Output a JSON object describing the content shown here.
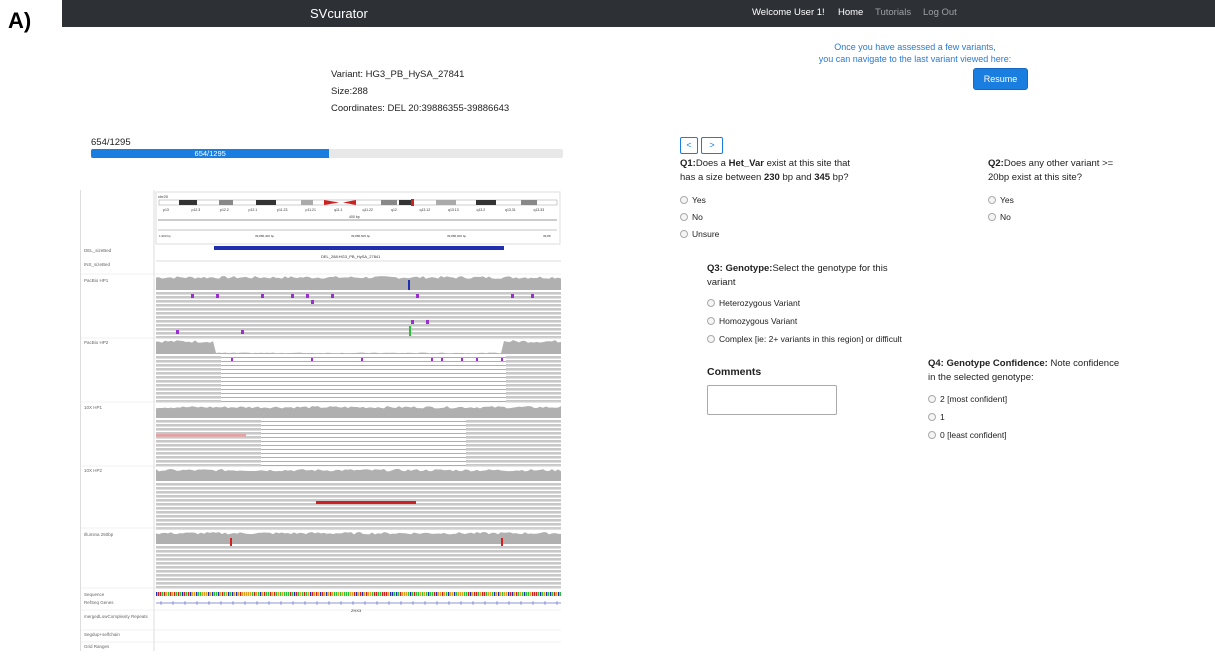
{
  "panel_label": "A)",
  "navbar": {
    "brand": "SVcurator",
    "welcome": "Welcome User 1!",
    "home": "Home",
    "tutorials": "Tutorials",
    "logout": "Log Out"
  },
  "resume": {
    "hint_line1": "Once you have assessed a few variants,",
    "hint_line2": "you can navigate to the last variant viewed here:",
    "button": "Resume"
  },
  "variant": {
    "name_line": "Variant: HG3_PB_HySA_27841",
    "size_line": "Size:288",
    "coords_line": "Coordinates: DEL 20:39886355-39886643"
  },
  "progress": {
    "label": "654/1295",
    "bar_label": "654/1295",
    "fraction": 0.505
  },
  "igv": {
    "chrom": "chr20",
    "bands": [
      "p13",
      "p12.3",
      "p12.2",
      "p12.1",
      "p11.23",
      "p11.21",
      "q11.1",
      "q11.22",
      "q12",
      "q13.12",
      "q13.13",
      "q13.2",
      "q13.31",
      "q13.33"
    ],
    "scale_label": "400 bp",
    "ruler": [
      "1,900 bp",
      "39,886,400 bp",
      "39,886,500 bp",
      "39,886,600 bp",
      "39,88"
    ],
    "feature_label": "DEL_288:HG3_PB_HySA_27841",
    "gene_label": "ZHX3",
    "tracks": [
      "DEL_sizeBed",
      "INS_sizeBed",
      "PacBio HP1",
      "PacBio HP2",
      "10X HP1",
      "10X HP2",
      "Illumina 250bp",
      "Sequence",
      "RefSeq Genes",
      "mergedLowComplexity Repeats",
      "Segdup+selfchain",
      "Grid Ranges"
    ]
  },
  "nav": {
    "prev": "<",
    "next": ">"
  },
  "q1": {
    "prefix": "Q1:",
    "text_a": "Does a ",
    "bold": "Het_Var",
    "text_b": " exist at this site that",
    "text_c": "has a size between ",
    "n1": "230",
    "text_d": " bp and ",
    "n2": "345",
    "text_e": " bp?",
    "options": [
      "Yes",
      "No",
      "Unsure"
    ]
  },
  "q2": {
    "prefix": "Q2:",
    "line1": "Does any other variant >=",
    "line2": "20bp exist at this site?",
    "options": [
      "Yes",
      "No"
    ]
  },
  "q3": {
    "prefix": "Q3: Genotype:",
    "line1": "Select the genotype for this",
    "line2": "variant",
    "options": [
      "Heterozygous Variant",
      "Homozygous Variant",
      "Complex [ie: 2+ variants in this region] or difficult"
    ]
  },
  "q4": {
    "prefix": "Q4: Genotype Confidence:",
    "line1": " Note confidence",
    "line2": "in the selected genotype:",
    "options": [
      "2 [most confident]",
      "1",
      "0 [least confident]"
    ]
  },
  "comments": {
    "label": "Comments"
  },
  "colors": {
    "navbar": "#2d3136",
    "accent": "#1a7ee0",
    "read": "#c8c8c8",
    "deletion": "#1f2fb0"
  }
}
